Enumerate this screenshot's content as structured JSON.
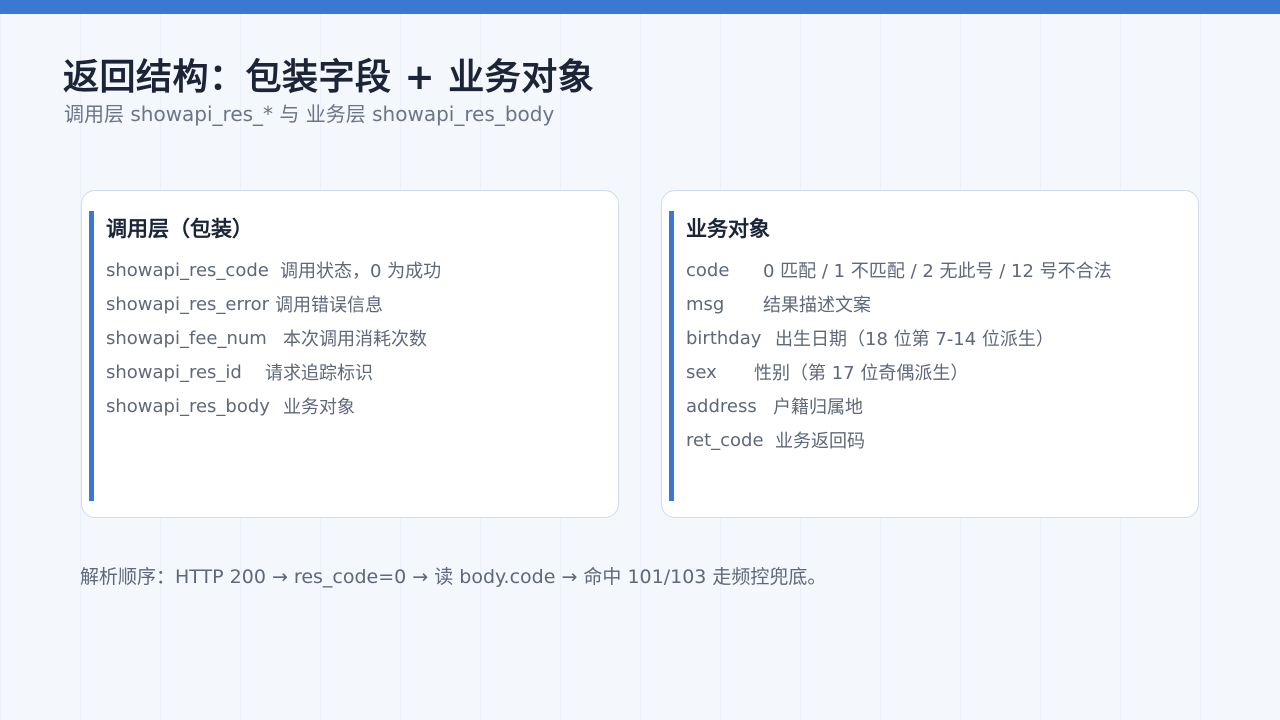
{
  "header": {
    "title": "返回结构：包装字段 + 业务对象",
    "subtitle": "调用层 showapi_res_*  与  业务层 showapi_res_body"
  },
  "left_card": {
    "title": "调用层（包装）",
    "rows": [
      {
        "key": "showapi_res_code",
        "desc": "调用状态，0 为成功"
      },
      {
        "key": "showapi_res_error",
        "desc": "调用错误信息"
      },
      {
        "key": "showapi_fee_num",
        "desc": "本次调用消耗次数"
      },
      {
        "key": "showapi_res_id",
        "desc": "请求追踪标识"
      },
      {
        "key": "showapi_res_body",
        "desc": "业务对象"
      }
    ]
  },
  "right_card": {
    "title": "业务对象",
    "rows": [
      {
        "key": "code",
        "desc": "0 匹配 / 1 不匹配 / 2 无此号 / 12 号不合法"
      },
      {
        "key": "msg",
        "desc": "结果描述文案"
      },
      {
        "key": "birthday",
        "desc": "出生日期（18 位第 7-14 位派生）"
      },
      {
        "key": "sex",
        "desc": "性别（第 17 位奇偶派生）"
      },
      {
        "key": "address",
        "desc": "户籍归属地"
      },
      {
        "key": "ret_code",
        "desc": "业务返回码"
      }
    ]
  },
  "footer": {
    "note": "解析顺序：HTTP 200 → res_code=0 → 读 body.code → 命中 101/103 走频控兜底。"
  },
  "colors": {
    "accent": "#3a78d4",
    "background": "#f4f7fc",
    "card_border": "#cfdcec"
  }
}
